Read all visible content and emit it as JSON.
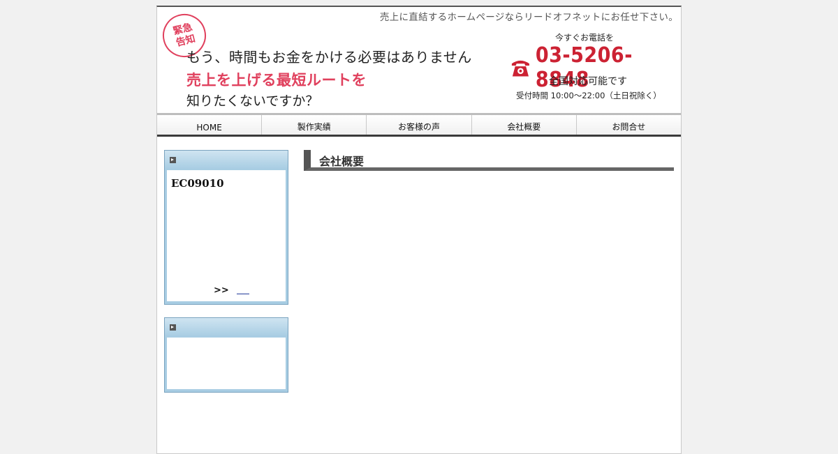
{
  "header": {
    "tagline": "売上に直結するホームページならリードオフネットにお任せ下さい。",
    "stamp_line1": "緊急",
    "stamp_line2": "告知",
    "headline1": "もう、時間もお金をかける必要はありません",
    "headline2": "売上を上げる最短ルートを",
    "headline3": "知りたくないですか？",
    "call_label": "今すぐお電話を",
    "phone_number": "03-5206-8848",
    "nationwide": "全国対応可能です",
    "hours": "受付時間 10:00〜22:00（土日祝除く）"
  },
  "nav": {
    "items": [
      {
        "label": "HOME"
      },
      {
        "label": "製作実績"
      },
      {
        "label": "お客様の声"
      },
      {
        "label": "会社概要"
      },
      {
        "label": "お問合せ"
      }
    ]
  },
  "sidebar": {
    "box1": {
      "code": "EC09010",
      "more": ">>"
    }
  },
  "main": {
    "section_title": "会社概要"
  },
  "colors": {
    "accent_red": "#e0405d",
    "phone_red": "#cc2233",
    "sidebar_blue": "#a8cde3"
  }
}
